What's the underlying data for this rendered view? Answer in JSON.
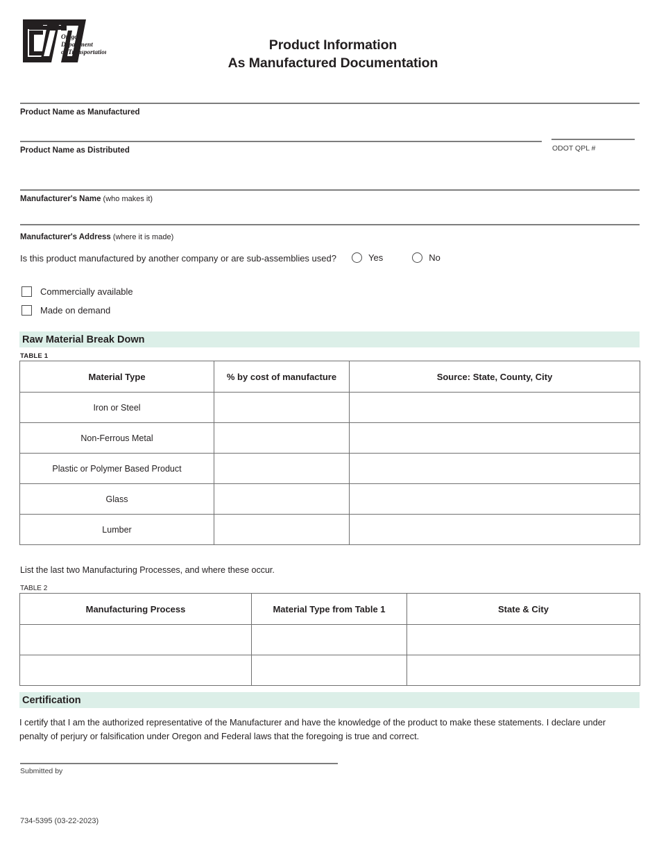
{
  "document": {
    "form_number": "734-5395 (03-22-2023)"
  },
  "header": {
    "agency_logo_name": "odot-logo",
    "agency_line1": "Oregon",
    "agency_line2": "Department",
    "agency_line3": "of Transportation",
    "title_line1": "Product Information",
    "title_line2": "As Manufactured Documentation"
  },
  "fields": {
    "product_name_manufactured": {
      "label": "Product Name as Manufactured",
      "value": "",
      "placeholder": ""
    },
    "product_name_distributed": {
      "label": "Product Name as Distributed",
      "value": "",
      "placeholder": ""
    },
    "odot_qpl": {
      "label": "ODOT QPL #",
      "value": "",
      "placeholder": ""
    },
    "manufacturer_name": {
      "label": "Manufacturer's Name",
      "hint": " (who makes it)",
      "value": "",
      "placeholder": ""
    },
    "manufacturer_address": {
      "label": "Manufacturer's Address",
      "hint": " (where it is made)",
      "value": "",
      "placeholder": ""
    },
    "submitted_by": {
      "label": "Submitted by",
      "value": "",
      "placeholder": ""
    }
  },
  "subassembly_question": {
    "text": "Is this product manufactured by another company or are sub-assemblies used?",
    "options": [
      {
        "label": "Yes",
        "selected": false
      },
      {
        "label": "No",
        "selected": false
      }
    ]
  },
  "availability_checkboxes": [
    {
      "label": "Commercially available",
      "checked": false
    },
    {
      "label": "Made on demand",
      "checked": false
    }
  ],
  "sections": {
    "raw_material": {
      "heading": "Raw Material Break Down",
      "bar_color": "#dcefe8"
    },
    "certification": {
      "heading": "Certification",
      "bar_color": "#dcefe8",
      "body": "I certify that I am the authorized representative of the Manufacturer and have the knowledge of the product to make these statements. I declare under penalty of perjury or falsification under Oregon and Federal laws that the foregoing is true and correct."
    }
  },
  "table1": {
    "caption": "TABLE 1",
    "columns": [
      "Material Type",
      "% by cost of manufacture",
      "Source: State, County, City"
    ],
    "rows": [
      {
        "material_type": "Iron or Steel",
        "percent": "",
        "source": ""
      },
      {
        "material_type": "Non-Ferrous Metal",
        "percent": "",
        "source": ""
      },
      {
        "material_type": "Plastic or Polymer Based Product",
        "percent": "",
        "source": ""
      },
      {
        "material_type": "Glass",
        "percent": "",
        "source": ""
      },
      {
        "material_type": "Lumber",
        "percent": "",
        "source": ""
      }
    ]
  },
  "table2": {
    "instruction": "List the last two Manufacturing Processes, and where these occur.",
    "caption": "TABLE 2",
    "columns": [
      "Manufacturing Process",
      "Material Type from Table 1",
      "State & City"
    ],
    "rows": [
      {
        "process": "",
        "material_type": "",
        "state_city": ""
      },
      {
        "process": "",
        "material_type": "",
        "state_city": ""
      }
    ]
  }
}
